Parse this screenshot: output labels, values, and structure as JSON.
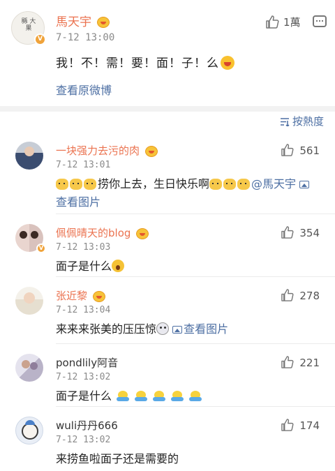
{
  "post": {
    "author": "馬天宇",
    "avatar_text": "縣 大 果",
    "time": "7-12 13:00",
    "text": "我！不！需！要！面！子！么",
    "view_original": "查看原微博",
    "likes": "1萬"
  },
  "sort_label": "按熱度",
  "comments": [
    {
      "user": "一块强力去污的肉",
      "time": "7-12 13:01",
      "text_part1": "捞你上去，生日快乐啊",
      "mention": "@馬天宇",
      "view_image": "查看图片",
      "likes": "561"
    },
    {
      "user": "佩佩晴天的blog",
      "time": "7-12 13:03",
      "text": "面子是什么",
      "likes": "354"
    },
    {
      "user": "张近黎",
      "time": "7-12 13:04",
      "text": "来来来张美的压压惊",
      "view_image": "查看图片",
      "likes": "278"
    },
    {
      "user": "pondlily阿音",
      "time": "7-12 13:02",
      "text": "面子是什么",
      "likes": "221"
    },
    {
      "user": "wuli丹丹666",
      "time": "7-12 13:02",
      "text": "来捞鱼啦面子还是需要的",
      "likes": "174"
    }
  ],
  "colors": {
    "username": "#eb7350",
    "link": "#4d6fa3",
    "time": "#8a8a8a",
    "verified_badge": "#f0a33a"
  },
  "icons": {
    "like": "thumbs-up-icon",
    "more": "more-icon",
    "sort": "sort-icon",
    "image": "image-icon",
    "verified": "verified-badge-icon"
  }
}
